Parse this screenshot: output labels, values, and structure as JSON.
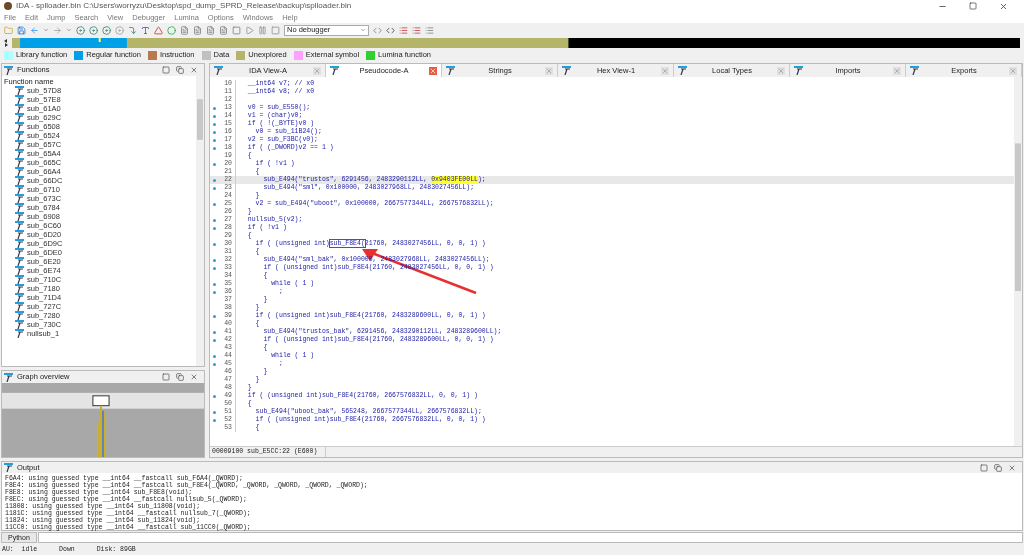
{
  "window": {
    "title": "IDA - splloader.bin C:\\Users\\worryzu\\Desktop\\spd_dump_SPRD_Release\\backup\\splloader.bin"
  },
  "menu": [
    "File",
    "Edit",
    "Jump",
    "Search",
    "View",
    "Debugger",
    "Lumina",
    "Options",
    "Windows",
    "Help"
  ],
  "toolbar": {
    "debugger_select": "No debugger"
  },
  "legend": [
    {
      "label": "Library function",
      "color": "#aaffff"
    },
    {
      "label": "Regular function",
      "color": "#00a0e8"
    },
    {
      "label": "Instruction",
      "color": "#b87850"
    },
    {
      "label": "Data",
      "color": "#c0c0c0"
    },
    {
      "label": "Unexplored",
      "color": "#b5b56a"
    },
    {
      "label": "External symbol",
      "color": "#ffa0ff"
    },
    {
      "label": "Lumina function",
      "color": "#30d030"
    }
  ],
  "functions_panel": {
    "title": "Functions",
    "column": "Function name",
    "items": [
      "sub_57D8",
      "sub_57E8",
      "sub_61A0",
      "sub_629C",
      "sub_6508",
      "sub_6524",
      "sub_657C",
      "sub_65A4",
      "sub_665C",
      "sub_66A4",
      "sub_66DC",
      "sub_6710",
      "sub_673C",
      "sub_6784",
      "sub_6908",
      "sub_6C60",
      "sub_6D20",
      "sub_6D9C",
      "sub_6DE0",
      "sub_6E20",
      "sub_6E74",
      "sub_710C",
      "sub_7180",
      "sub_71D4",
      "sub_727C",
      "sub_7280",
      "sub_730C",
      "nullsub_1"
    ]
  },
  "graph_overview": {
    "title": "Graph overview"
  },
  "tabs": [
    {
      "label": "IDA View-A",
      "selected": false
    },
    {
      "label": "Pseudocode-A",
      "selected": true
    },
    {
      "label": "Strings",
      "selected": false
    },
    {
      "label": "Hex View-1",
      "selected": false
    },
    {
      "label": "Local Types",
      "selected": false
    },
    {
      "label": "Imports",
      "selected": false
    },
    {
      "label": "Exports",
      "selected": false
    }
  ],
  "code": [
    {
      "n": "10",
      "dot": false,
      "selected": false,
      "text": "  __int64 v7; // x0"
    },
    {
      "n": "11",
      "dot": false,
      "selected": false,
      "text": "  __int64 v8; // x0"
    },
    {
      "n": "12",
      "dot": false,
      "selected": false
    },
    {
      "n": "13",
      "dot": true,
      "selected": false,
      "text": "  v0 = sub_E550();"
    },
    {
      "n": "14",
      "dot": true,
      "selected": false,
      "text": "  v1 = (char)v0;"
    },
    {
      "n": "15",
      "dot": true,
      "selected": false,
      "text": "  if ( !(_BYTE)v0 )"
    },
    {
      "n": "16",
      "dot": true,
      "selected": false,
      "text": "    v0 = sub_11B24();"
    },
    {
      "n": "17",
      "dot": true,
      "selected": false,
      "text": "  v2 = sub_F3BC(v0);"
    },
    {
      "n": "18",
      "dot": true,
      "selected": false,
      "text": "  if ( (_DWORD)v2 == 1 )"
    },
    {
      "n": "19",
      "dot": false,
      "selected": false,
      "text": "  {"
    },
    {
      "n": "20",
      "dot": true,
      "selected": false,
      "text": "    if ( !v1 )"
    },
    {
      "n": "21",
      "dot": false,
      "selected": false,
      "text": "    {"
    },
    {
      "n": "22",
      "dot": true,
      "selected": true,
      "text": "      sub_E494(\"trustos\", 6291456, 2483290112LL, ",
      "mark": {
        "kind": "highlight",
        "text": "0x9403FE00LL"
      },
      "rest": ");"
    },
    {
      "n": "23",
      "dot": true,
      "selected": false,
      "text": "      sub_E494(\"sml\", 0x100000, 2483027968LL, 2483027456LL);"
    },
    {
      "n": "24",
      "dot": false,
      "selected": false,
      "text": "    }"
    },
    {
      "n": "25",
      "dot": true,
      "selected": false,
      "text": "    v2 = sub_E494(\"uboot\", 0x100000, 2667577344LL, 2667576832LL);"
    },
    {
      "n": "26",
      "dot": false,
      "selected": false,
      "text": "  }"
    },
    {
      "n": "27",
      "dot": true,
      "selected": false,
      "text": "  nullsub_5(v2);"
    },
    {
      "n": "28",
      "dot": true,
      "selected": false,
      "text": "  if ( !v1 )"
    },
    {
      "n": "29",
      "dot": false,
      "selected": false,
      "text": "  {"
    },
    {
      "n": "30",
      "dot": true,
      "selected": false,
      "text": "    if ( (unsigned int)",
      "mark": {
        "kind": "box",
        "text": "sub_F8E4("
      },
      "rest": "21760, 2483027456LL, 0, 0, 1) )"
    },
    {
      "n": "31",
      "dot": false,
      "selected": false,
      "text": "    {"
    },
    {
      "n": "32",
      "dot": true,
      "selected": false,
      "text": "      sub_E494(\"sml_bak\", 0x100000, 2483027968LL, 2483027456LL);"
    },
    {
      "n": "33",
      "dot": true,
      "selected": false,
      "text": "      if ( (unsigned int)sub_F8E4(21760, 2483027456LL, 0, 0, 1) )"
    },
    {
      "n": "34",
      "dot": false,
      "selected": false,
      "text": "      {"
    },
    {
      "n": "35",
      "dot": true,
      "selected": false,
      "text": "        while ( 1 )"
    },
    {
      "n": "36",
      "dot": true,
      "selected": false,
      "text": "          ;"
    },
    {
      "n": "37",
      "dot": false,
      "selected": false,
      "text": "      }"
    },
    {
      "n": "38",
      "dot": false,
      "selected": false,
      "text": "    }"
    },
    {
      "n": "39",
      "dot": true,
      "selected": false,
      "text": "    if ( (unsigned int)sub_F8E4(21760, 2483289600LL, 0, 0, 1) )"
    },
    {
      "n": "40",
      "dot": false,
      "selected": false,
      "text": "    {"
    },
    {
      "n": "41",
      "dot": true,
      "selected": false,
      "text": "      sub_E494(\"trustos_bak\", 6291456, 2483290112LL, 2483289600LL);"
    },
    {
      "n": "42",
      "dot": true,
      "selected": false,
      "text": "      if ( (unsigned int)sub_F8E4(21760, 2483289600LL, 0, 0, 1) )"
    },
    {
      "n": "43",
      "dot": false,
      "selected": false,
      "text": "      {"
    },
    {
      "n": "44",
      "dot": true,
      "selected": false,
      "text": "        while ( 1 )"
    },
    {
      "n": "45",
      "dot": true,
      "selected": false,
      "text": "          ;"
    },
    {
      "n": "46",
      "dot": false,
      "selected": false,
      "text": "      }"
    },
    {
      "n": "47",
      "dot": false,
      "selected": false,
      "text": "    }"
    },
    {
      "n": "48",
      "dot": false,
      "selected": false,
      "text": "  }"
    },
    {
      "n": "49",
      "dot": true,
      "selected": false,
      "text": "  if ( (unsigned int)sub_F8E4(21760, 2667576832LL, 0, 0, 1) )"
    },
    {
      "n": "50",
      "dot": false,
      "selected": false,
      "text": "  {"
    },
    {
      "n": "51",
      "dot": true,
      "selected": false,
      "text": "    sub_E494(\"uboot_bak\", 565248, 2667577344LL, 2667576832LL);"
    },
    {
      "n": "52",
      "dot": true,
      "selected": false,
      "text": "    if ( (unsigned int)sub_F8E4(21760, 2667576832LL, 0, 0, 1) )"
    },
    {
      "n": "53",
      "dot": false,
      "selected": false,
      "text": "    {"
    }
  ],
  "code_status": "00009100 sub_E5CC:22 (E600)",
  "output": {
    "title": "Output",
    "lines": [
      "F6A4: using guessed type __int64 __fastcall sub_F6A4(_QWORD);",
      "F8E4: using guessed type __int64 __fastcall sub_F8E4(_QWORD, _QWORD, _QWORD, _QWORD, _QWORD);",
      "F8E8: using guessed type __int64 sub_F8E8(void);",
      "F8EC: using guessed type __int64 __fastcall nullsub_5(_QWORD);",
      "11808: using guessed type __int64 sub_11808(void);",
      "1181C: using guessed type __int64 __fastcall nullsub_7(_QWORD);",
      "11824: using guessed type __int64 sub_11824(void);",
      "11CC0: using guessed type __int64 __fastcall sub_11CC0(_QWORD);"
    ]
  },
  "python_button": "Python",
  "status_bar": [
    "AU:  idle",
    "Down",
    "Disk: 89GB"
  ]
}
